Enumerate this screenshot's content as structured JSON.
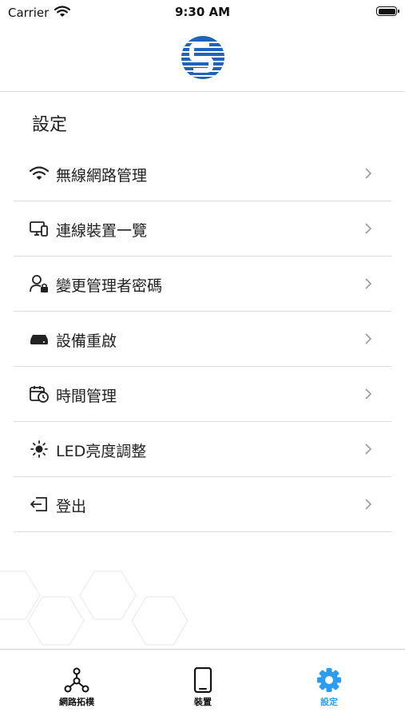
{
  "status_bar": {
    "carrier": "Carrier",
    "time": "9:30 AM"
  },
  "page": {
    "title": "設定"
  },
  "menu": {
    "items": [
      {
        "label": "無線網路管理",
        "icon": "wifi-icon"
      },
      {
        "label": "連線裝置一覽",
        "icon": "devices-icon"
      },
      {
        "label": "變更管理者密碼",
        "icon": "user-lock-icon"
      },
      {
        "label": "設備重啟",
        "icon": "router-icon"
      },
      {
        "label": "時間管理",
        "icon": "calendar-clock-icon"
      },
      {
        "label": "LED亮度調整",
        "icon": "brightness-icon"
      },
      {
        "label": "登出",
        "icon": "logout-icon"
      }
    ]
  },
  "tab_bar": {
    "tabs": [
      {
        "label": "網路拓樸",
        "icon": "network-topology-icon",
        "active": false
      },
      {
        "label": "裝置",
        "icon": "phone-icon",
        "active": false
      },
      {
        "label": "設定",
        "icon": "gear-icon",
        "active": true
      }
    ]
  },
  "colors": {
    "accent": "#2b9cf0",
    "logo_blue": "#1f64b8",
    "divider": "#dcdcdc"
  }
}
